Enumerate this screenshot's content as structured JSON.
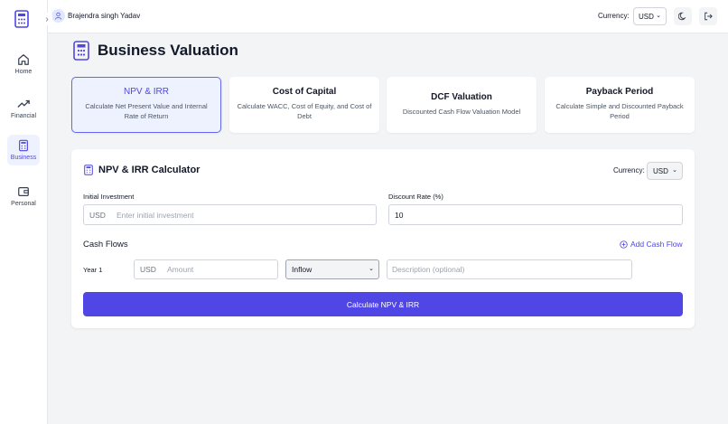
{
  "user": {
    "name": "Brajendra singh Yadav"
  },
  "topbar": {
    "currency_label": "Currency:",
    "currency_value": "USD"
  },
  "sidebar": {
    "items": [
      {
        "label": "Home",
        "icon": "home-icon"
      },
      {
        "label": "Financial",
        "icon": "trending-up-icon"
      },
      {
        "label": "Business",
        "icon": "calculator-icon",
        "active": true
      },
      {
        "label": "Personal",
        "icon": "wallet-icon"
      }
    ]
  },
  "page": {
    "title": "Business Valuation"
  },
  "tools": [
    {
      "title": "NPV & IRR",
      "desc": "Calculate Net Present Value and Internal Rate of Return",
      "active": true
    },
    {
      "title": "Cost of Capital",
      "desc": "Calculate WACC, Cost of Equity, and Cost of Debt"
    },
    {
      "title": "DCF Valuation",
      "desc": "Discounted Cash Flow Valuation Model"
    },
    {
      "title": "Payback Period",
      "desc": "Calculate Simple and Discounted Payback Period"
    }
  ],
  "calculator": {
    "title": "NPV & IRR Calculator",
    "currency_label": "Currency:",
    "currency_value": "USD",
    "initial_investment": {
      "label": "Initial Investment",
      "prefix": "USD",
      "placeholder": "Enter initial investment"
    },
    "discount_rate": {
      "label": "Discount Rate (%)",
      "value": "10"
    },
    "cash_flows": {
      "heading": "Cash Flows",
      "add_label": "Add Cash Flow",
      "rows": [
        {
          "year_label": "Year 1",
          "prefix": "USD",
          "amount_placeholder": "Amount",
          "type": "Inflow",
          "description_placeholder": "Description (optional)"
        }
      ]
    },
    "button_label": "Calculate NPV & IRR"
  },
  "colors": {
    "accent": "#4f46e5",
    "accent_light": "#eef2ff"
  }
}
